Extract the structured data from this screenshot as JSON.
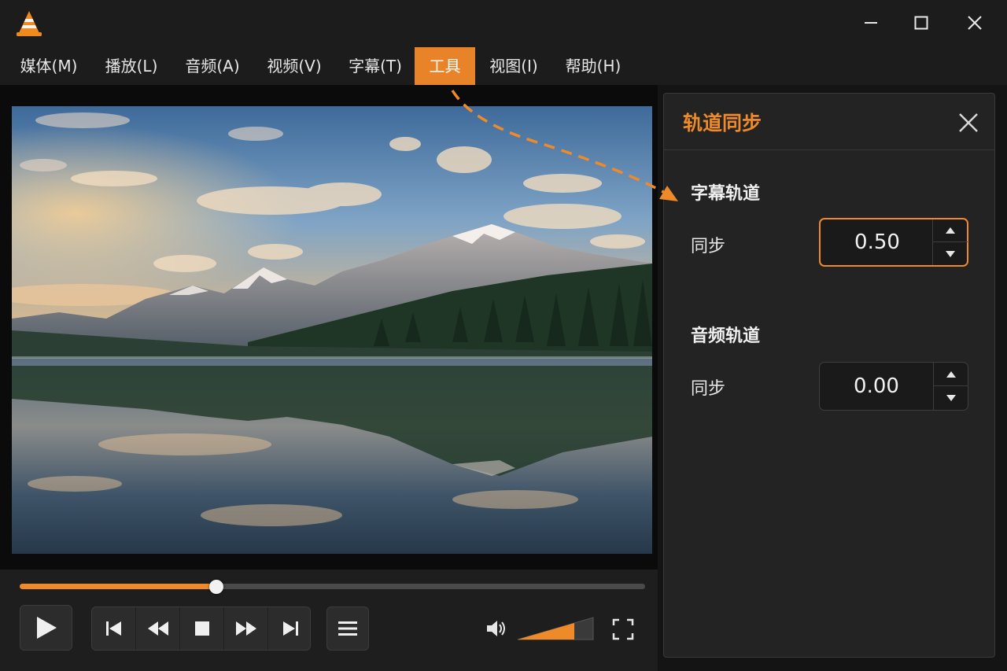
{
  "window": {
    "app_icon": "vlc-cone-icon",
    "controls": [
      "minimize-icon",
      "maximize-icon",
      "close-icon"
    ]
  },
  "menu": {
    "items": [
      {
        "label": "媒体(M)"
      },
      {
        "label": "播放(L)"
      },
      {
        "label": "音频(A)"
      },
      {
        "label": "视频(V)"
      },
      {
        "label": "字幕(T)"
      },
      {
        "label": "工具",
        "active": true
      },
      {
        "label": "视图(I)"
      },
      {
        "label": "帮助(H)"
      }
    ]
  },
  "player": {
    "seek_progress": 0.315,
    "volume_level": 0.75,
    "accent_color": "#ef8a2b",
    "buttons": [
      "play-icon",
      "skip-previous-icon",
      "rewind-icon",
      "stop-icon",
      "fast-forward-icon",
      "skip-next-icon",
      "playlist-icon",
      "volume-icon",
      "fullscreen-icon"
    ]
  },
  "sync_panel": {
    "title": "轨道同步",
    "subtitle_track": {
      "heading": "字幕轨道",
      "label": "同步",
      "value": "0.50"
    },
    "audio_track": {
      "heading": "音频轨道",
      "label": "同步",
      "value": "0.00"
    }
  }
}
